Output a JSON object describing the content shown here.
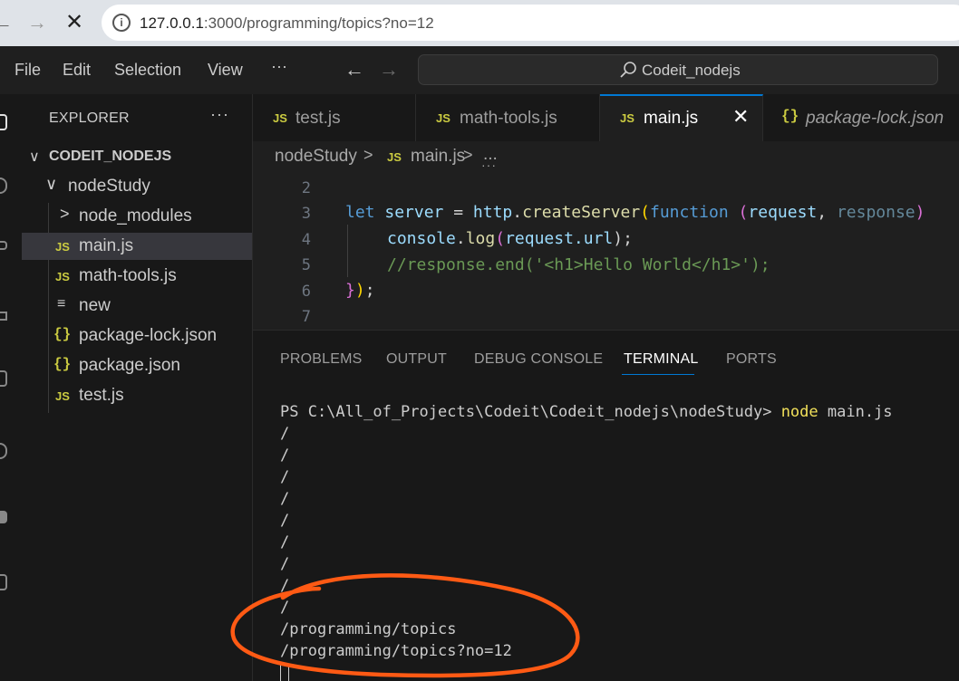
{
  "browser": {
    "back": "←",
    "forward": "→",
    "stop": "✕",
    "url_host": "127.0.0.1",
    "url_rest": ":3000/programming/topics?no=12"
  },
  "menu": {
    "file": "File",
    "edit": "Edit",
    "selection": "Selection",
    "view": "View",
    "more": "···",
    "back": "←",
    "forward": "→",
    "command_center": "Codeit_nodejs"
  },
  "sidebar": {
    "title": "EXPLORER",
    "more": "···",
    "project": "CODEIT_NODEJS",
    "items": [
      {
        "label": "nodeStudy",
        "kind": "folder-open"
      },
      {
        "label": "node_modules",
        "kind": "folder-closed"
      },
      {
        "label": "main.js",
        "kind": "js",
        "selected": true
      },
      {
        "label": "math-tools.js",
        "kind": "js"
      },
      {
        "label": "new",
        "kind": "text"
      },
      {
        "label": "package-lock.json",
        "kind": "json"
      },
      {
        "label": "package.json",
        "kind": "json"
      },
      {
        "label": "test.js",
        "kind": "js"
      }
    ]
  },
  "tabs": [
    {
      "label": "test.js",
      "kind": "js"
    },
    {
      "label": "math-tools.js",
      "kind": "js"
    },
    {
      "label": "main.js",
      "kind": "js",
      "active": true,
      "close": "✕"
    },
    {
      "label": "package-lock.json",
      "kind": "json"
    }
  ],
  "icons": {
    "js_badge": "JS",
    "json_badge": "{}",
    "text_badge": "≡",
    "chevron_down": "∨",
    "chevron_right": ">"
  },
  "breadcrumb": {
    "folder": "nodeStudy",
    "sep": ">",
    "file": "main.js",
    "tail": "...",
    "dots": "···"
  },
  "editor": {
    "line_numbers": [
      "2",
      "3",
      "4",
      "5",
      "6",
      "7"
    ],
    "line3": {
      "kw": "let",
      "var": "server",
      "eq": " = ",
      "obj": "http",
      "dot": ".",
      "fn": "createServer",
      "open": "(",
      "kw2": "function",
      "sp": " ",
      "popen": "(",
      "p1": "request",
      "comma": ", ",
      "p2": "response",
      "pclose": ")"
    },
    "line4": {
      "obj": "console",
      "dot": ".",
      "fn": "log",
      "open": "(",
      "arg": "request.url",
      "close": ");"
    },
    "line5": "//response.end('<h1>Hello World</h1>');",
    "line6": {
      "brace": "}",
      "paren": ")",
      "semi": ";"
    }
  },
  "panel": {
    "tabs": [
      "PROBLEMS",
      "OUTPUT",
      "DEBUG CONSOLE",
      "TERMINAL",
      "PORTS"
    ],
    "active_tab": "TERMINAL",
    "prompt": "PS C:\\All_of_Projects\\Codeit\\Codeit_nodejs\\nodeStudy> ",
    "command": "node",
    "command_arg": " main.js",
    "output": [
      "/",
      "/",
      "/",
      "/",
      "/",
      "/",
      "/",
      "/",
      "/",
      "/programming/topics",
      "/programming/topics?no=12"
    ]
  },
  "colors": {
    "accent": "#0078d4",
    "annotation": "#ff5a14"
  }
}
